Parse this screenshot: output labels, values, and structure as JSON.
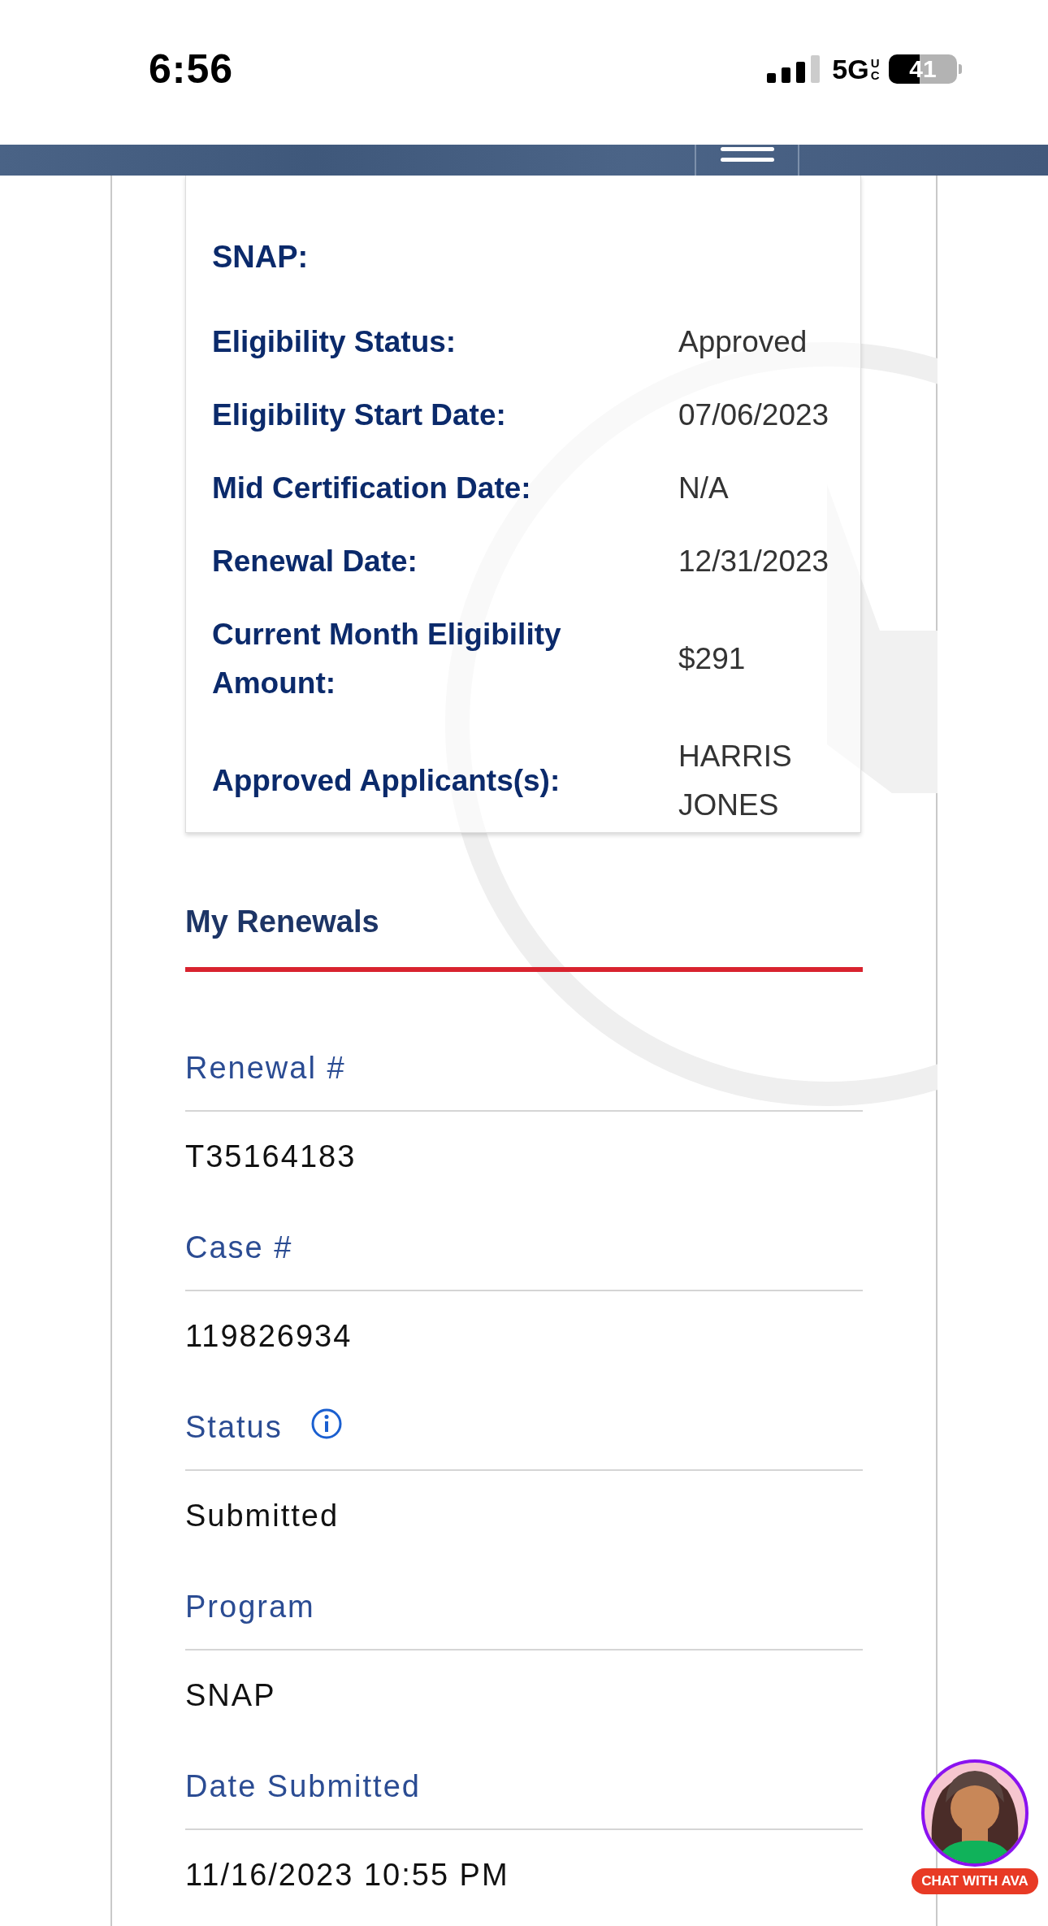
{
  "status_bar": {
    "time": "6:56",
    "network": "5G",
    "network_badge": "UC",
    "battery": "41"
  },
  "snap_card": {
    "title": "SNAP:",
    "rows": [
      {
        "label": "Eligibility Status:",
        "value": "Approved"
      },
      {
        "label": "Eligibility Start Date:",
        "value": "07/06/2023"
      },
      {
        "label": "Mid Certification Date:",
        "value": "N/A"
      },
      {
        "label": "Renewal Date:",
        "value": "12/31/2023"
      },
      {
        "label": "Current Month Eligibility Amount:",
        "value": "$291"
      },
      {
        "label": "Approved Applicants(s):",
        "value": "HARRIS JONES"
      }
    ]
  },
  "renewals": {
    "title": "My Renewals",
    "fields": [
      {
        "label": "Renewal #",
        "value": "T35164183",
        "info": false
      },
      {
        "label": "Case #",
        "value": "119826934",
        "info": false
      },
      {
        "label": "Status",
        "value": "Submitted",
        "info": true
      },
      {
        "label": "Program",
        "value": "SNAP",
        "info": false
      },
      {
        "label": "Date Submitted",
        "value": "11/16/2023 10:55 PM",
        "info": false
      }
    ]
  },
  "chat": {
    "label": "CHAT WITH AVA"
  }
}
